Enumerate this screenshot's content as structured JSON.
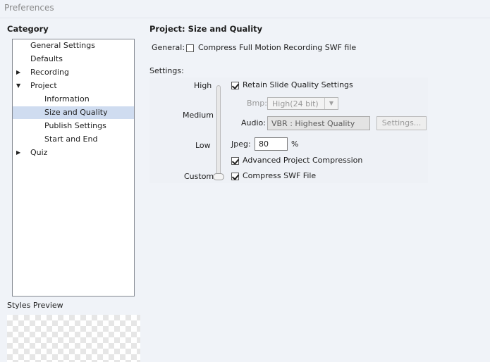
{
  "window": {
    "title": "Preferences"
  },
  "category": {
    "title": "Category",
    "items": [
      {
        "label": "General Settings",
        "expander": ""
      },
      {
        "label": "Defaults",
        "expander": ""
      },
      {
        "label": "Recording",
        "expander": "▶"
      },
      {
        "label": "Project",
        "expander": "▼"
      },
      {
        "label": "Information",
        "expander": ""
      },
      {
        "label": "Size and Quality",
        "expander": ""
      },
      {
        "label": "Publish Settings",
        "expander": ""
      },
      {
        "label": "Start and End",
        "expander": ""
      },
      {
        "label": "Quiz",
        "expander": "▶"
      }
    ],
    "selected": "Size and Quality"
  },
  "styles_preview": {
    "title": "Styles Preview"
  },
  "main": {
    "title": "Project: Size and Quality",
    "general": {
      "label": "General:",
      "compress_full_motion": {
        "label": "Compress Full Motion Recording SWF file",
        "checked": false
      }
    },
    "settings": {
      "label": "Settings:",
      "slider": {
        "levels": [
          "High",
          "Medium",
          "Low",
          "Custom"
        ],
        "current": "Custom"
      },
      "retain_slide_quality": {
        "label": "Retain Slide Quality Settings",
        "checked": true
      },
      "bmp": {
        "label": "Bmp:",
        "value": "High(24 bit)",
        "enabled": false
      },
      "audio": {
        "label": "Audio:",
        "value": "VBR : Highest Quality",
        "button_label": "Settings..."
      },
      "jpeg": {
        "label": "Jpeg:",
        "value": "80",
        "unit": "%"
      },
      "advanced_compression": {
        "label": "Advanced Project Compression",
        "checked": true
      },
      "compress_swf": {
        "label": "Compress SWF File",
        "checked": true
      }
    }
  }
}
